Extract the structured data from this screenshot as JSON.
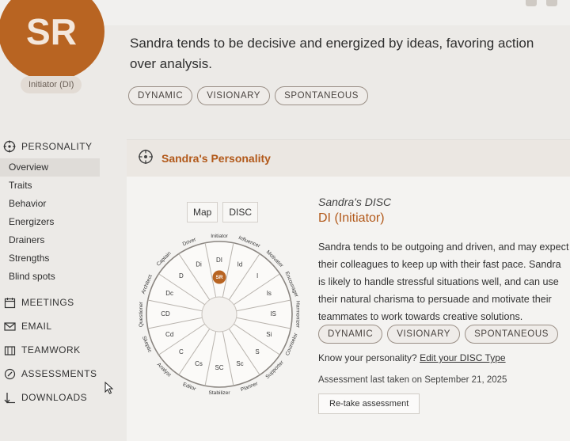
{
  "profile": {
    "initials": "SR",
    "badge": "Initiator (DI)",
    "summary": "Sandra tends to be decisive and energized by ideas, favoring action over analysis.",
    "traits": [
      "DYNAMIC",
      "VISIONARY",
      "SPONTANEOUS"
    ]
  },
  "sidebar": {
    "personality": {
      "label": "PERSONALITY",
      "icon": "personality-target-icon",
      "items": [
        {
          "label": "Overview",
          "active": true
        },
        {
          "label": "Traits"
        },
        {
          "label": "Behavior"
        },
        {
          "label": "Energizers"
        },
        {
          "label": "Drainers"
        },
        {
          "label": "Strengths"
        },
        {
          "label": "Blind spots"
        }
      ]
    },
    "sections": [
      {
        "label": "MEETINGS",
        "icon": "calendar-icon"
      },
      {
        "label": "EMAIL",
        "icon": "mail-icon"
      },
      {
        "label": "TEAMWORK",
        "icon": "teamwork-icon"
      },
      {
        "label": "ASSESSMENTS",
        "icon": "assessment-icon"
      },
      {
        "label": "DOWNLOADS",
        "icon": "download-icon"
      }
    ]
  },
  "panel": {
    "title": "Sandra's Personality",
    "tabs": [
      "Map",
      "DISC"
    ],
    "disc_subtitle": "Sandra's DISC",
    "disc_type": "DI (Initiator)",
    "description": "Sandra tends to be outgoing and driven, and may expect their colleagues to keep up with their fast pace. Sandra is likely to handle stressful situations well, and can use their natural charisma to persuade and motivate their teammates to work towards creative solutions.",
    "traits": [
      "DYNAMIC",
      "VISIONARY",
      "SPONTANEOUS"
    ],
    "know_prompt": "Know your personality?",
    "know_link": "Edit your DISC Type",
    "last_taken": "Assessment last taken on September 21, 2025",
    "retake": "Re-take assessment"
  },
  "wheel": {
    "center_marker": "SR",
    "outer_labels": [
      "Initiator",
      "Influencer",
      "Motivator",
      "Encourager",
      "Harmonizer",
      "Counselor",
      "Supporter",
      "Planner",
      "Stabilizer",
      "Editor",
      "Analyst",
      "Skeptic",
      "Questioner",
      "Architect",
      "Captain",
      "Driver"
    ],
    "inner_labels": [
      "DI",
      "Id",
      "I",
      "Is",
      "IS",
      "Si",
      "S",
      "Sc",
      "SC",
      "Cs",
      "C",
      "Cd",
      "CD",
      "Dc",
      "D",
      "Di"
    ],
    "accent": "#b86422"
  }
}
